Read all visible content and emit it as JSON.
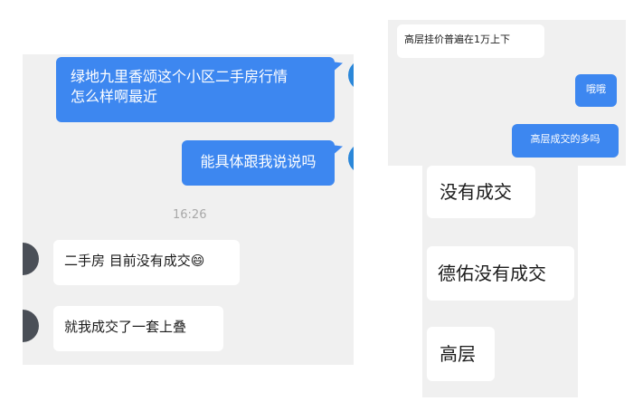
{
  "left_chat": {
    "messages_out": [
      {
        "text_line1": "绿地九里香颂这个小区二手房行情",
        "text_line2": "怎么样啊最近"
      },
      {
        "text": "能具体跟我说说吗"
      }
    ],
    "timestamp": "16:26",
    "messages_in": [
      {
        "text": "二手房 目前没有成交😄"
      },
      {
        "text": "就我成交了一套上叠"
      }
    ]
  },
  "top_right_chat": {
    "message_in": "高层挂价普遍在1万上下",
    "messages_out": [
      "哦哦",
      "高层成交的多吗"
    ]
  },
  "bottom_right_chat": {
    "messages_in": [
      "没有成交",
      "德佑没有成交",
      "高层"
    ]
  },
  "colors": {
    "outgoing_bubble": "#3d87f0",
    "incoming_bubble": "#ffffff",
    "chat_background": "#f0f0f0",
    "self_avatar": "#2b87d9"
  }
}
